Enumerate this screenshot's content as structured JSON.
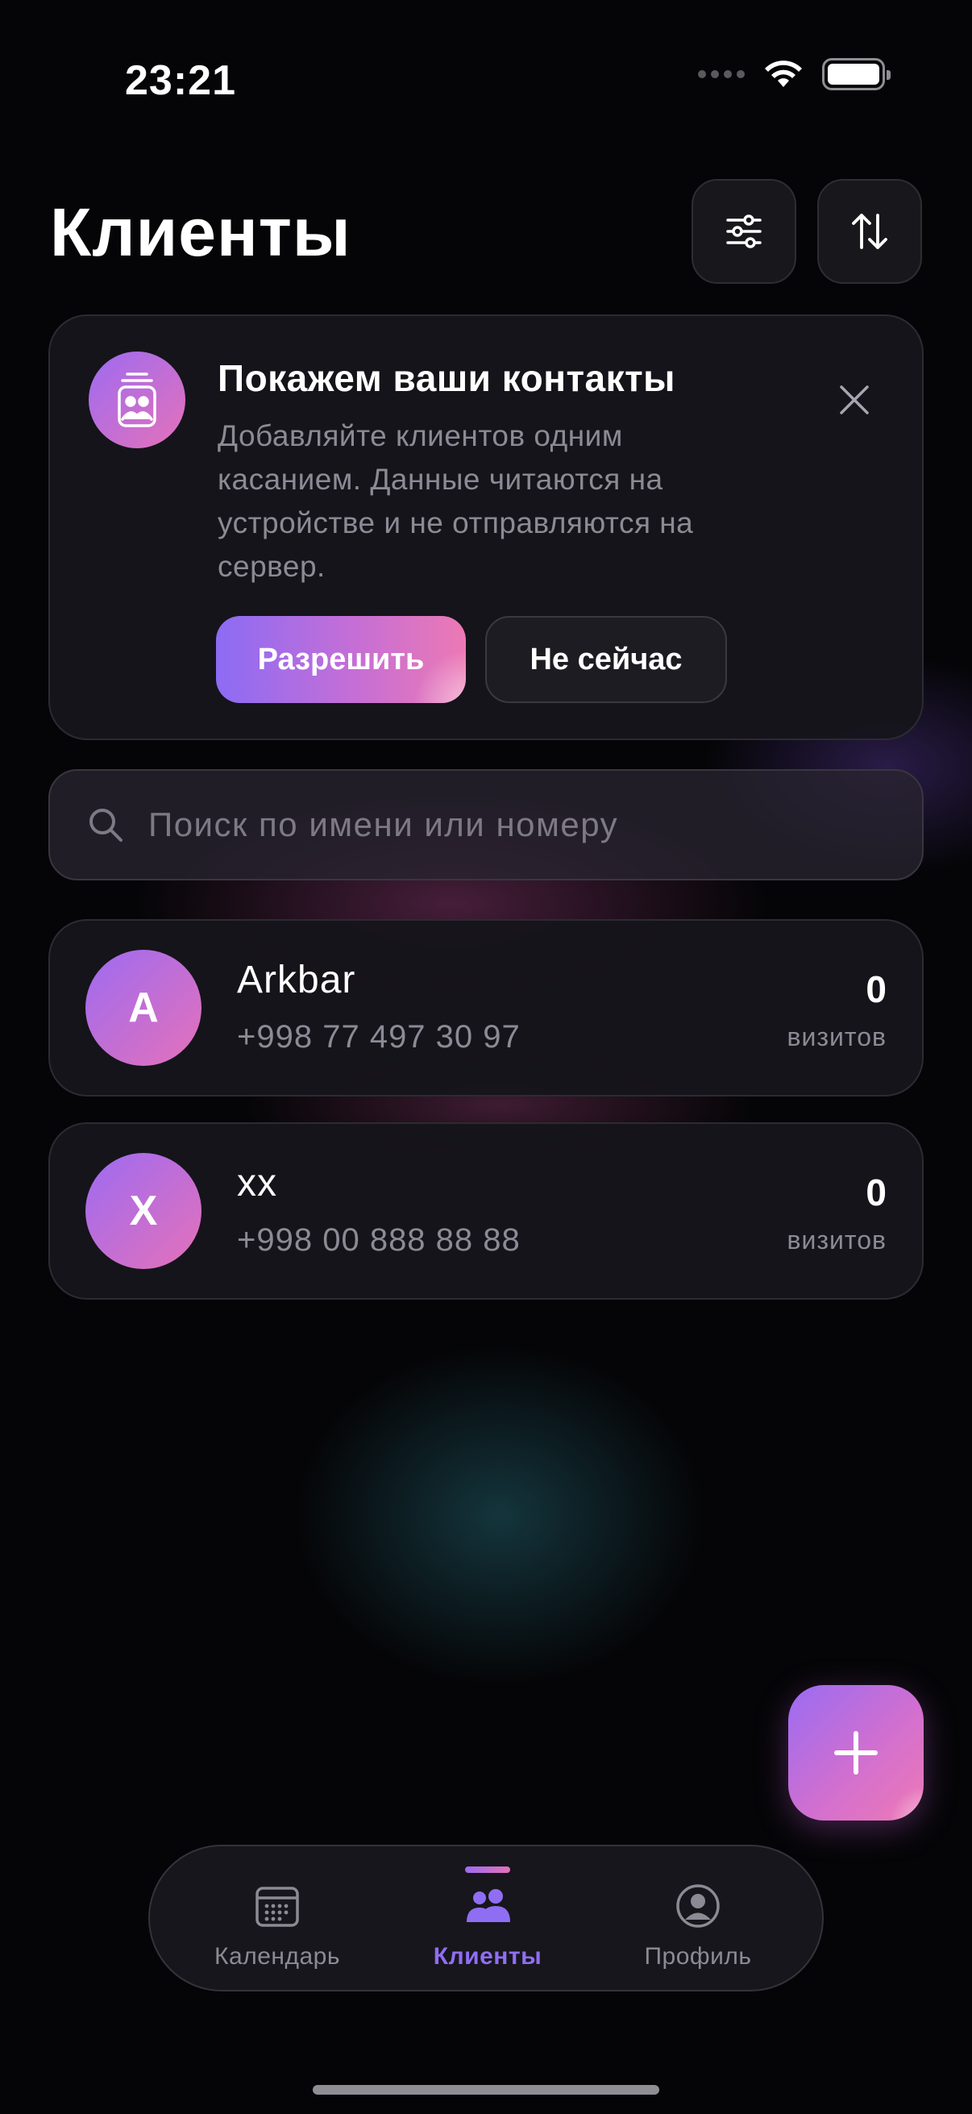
{
  "status_bar": {
    "time": "23:21"
  },
  "header": {
    "title": "Клиенты"
  },
  "permission_card": {
    "title": "Покажем ваши контакты",
    "description": "Добавляйте клиентов одним касанием. Данные читаются на устройстве и не отправляются на сервер.",
    "allow_label": "Разрешить",
    "later_label": "Не сейчас"
  },
  "search": {
    "placeholder": "Поиск по имени или номеру",
    "value": ""
  },
  "clients": [
    {
      "initial": "A",
      "name": "Arkbar",
      "phone": "+998 77 497 30 97",
      "visits": "0",
      "visits_label": "визитов"
    },
    {
      "initial": "X",
      "name": "xx",
      "phone": "+998 00 888 88 88",
      "visits": "0",
      "visits_label": "визитов"
    }
  ],
  "tabs": [
    {
      "label": "Календарь",
      "icon": "calendar-icon",
      "active": false
    },
    {
      "label": "Клиенты",
      "icon": "users-icon",
      "active": true
    },
    {
      "label": "Профиль",
      "icon": "profile-icon",
      "active": false
    }
  ],
  "colors": {
    "accent_start": "#9d6bf2",
    "accent_end": "#e571b9",
    "active_tab": "#8f6ef3",
    "background": "#050507"
  }
}
